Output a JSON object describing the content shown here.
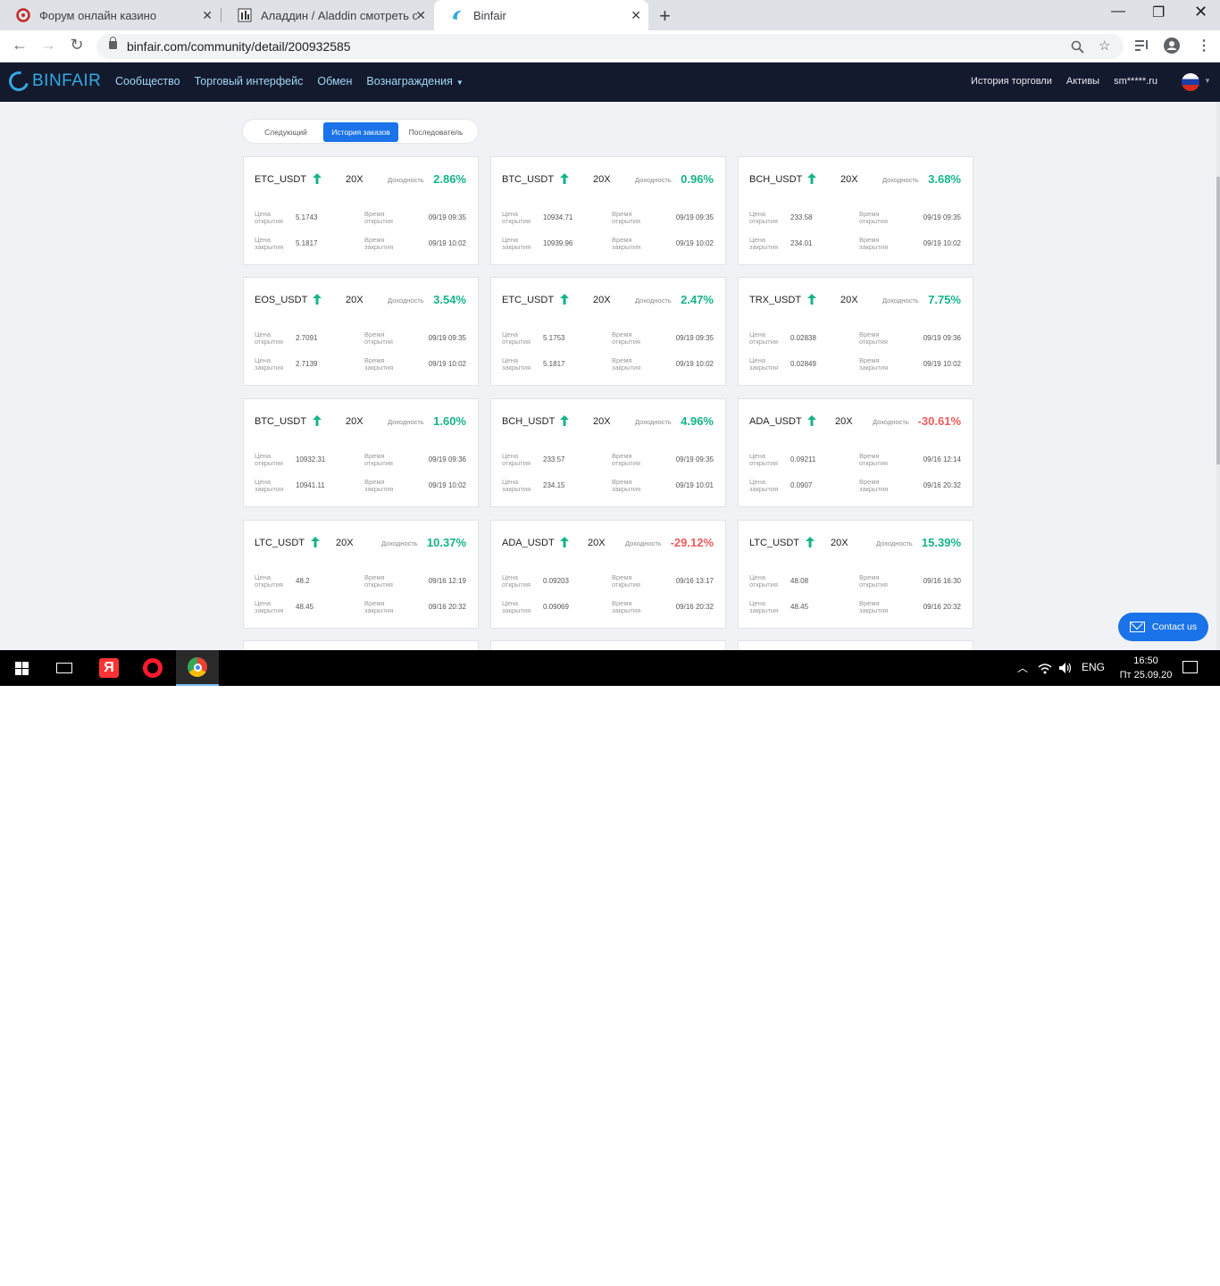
{
  "browser": {
    "tabs": [
      {
        "title": "Форум онлайн казино",
        "active": false
      },
      {
        "title": "Аладдин / Aladdin смотреть онл",
        "active": false
      },
      {
        "title": "Binfair",
        "active": true
      }
    ],
    "url": "binfair.com/community/detail/200932585"
  },
  "site": {
    "logo": "BINFAIR",
    "nav": {
      "community": "Сообщество",
      "trading": "Торговый интерфейс",
      "exchange": "Обмен",
      "rewards": "Вознаграждения"
    },
    "right": {
      "history": "История торговли",
      "assets": "Активы",
      "user": "sm*****.ru"
    }
  },
  "filters": {
    "following": "Следующий",
    "order_history": "История заказов",
    "follower": "Последователь"
  },
  "labels": {
    "yield": "Доходность",
    "open_price_1": "Цена",
    "open_price_2": "открытия",
    "close_price_1": "Цена",
    "close_price_2": "закрытия",
    "open_time_1": "Время",
    "open_time_2": "открытия",
    "close_time_1": "Время",
    "close_time_2": "закрытия"
  },
  "cards": [
    {
      "pair": "ETC_USDT",
      "lev": "20X",
      "yield": "2.86%",
      "positive": true,
      "open": "5.1743",
      "close": "5.1817",
      "open_time": "09/19 09:35",
      "close_time": "09/19 10:02"
    },
    {
      "pair": "BTC_USDT",
      "lev": "20X",
      "yield": "0.96%",
      "positive": true,
      "open": "10934.71",
      "close": "10939.96",
      "open_time": "09/19 09:35",
      "close_time": "09/19 10:02"
    },
    {
      "pair": "BCH_USDT",
      "lev": "20X",
      "yield": "3.68%",
      "positive": true,
      "open": "233.58",
      "close": "234.01",
      "open_time": "09/19 09:35",
      "close_time": "09/19 10:02"
    },
    {
      "pair": "EOS_USDT",
      "lev": "20X",
      "yield": "3.54%",
      "positive": true,
      "open": "2.7091",
      "close": "2.7139",
      "open_time": "09/19 09:35",
      "close_time": "09/19 10:02"
    },
    {
      "pair": "ETC_USDT",
      "lev": "20X",
      "yield": "2.47%",
      "positive": true,
      "open": "5.1753",
      "close": "5.1817",
      "open_time": "09/19 09:35",
      "close_time": "09/19 10:02"
    },
    {
      "pair": "TRX_USDT",
      "lev": "20X",
      "yield": "7.75%",
      "positive": true,
      "open": "0.02838",
      "close": "0.02849",
      "open_time": "09/19 09:36",
      "close_time": "09/19 10:02"
    },
    {
      "pair": "BTC_USDT",
      "lev": "20X",
      "yield": "1.60%",
      "positive": true,
      "open": "10932.31",
      "close": "10941.11",
      "open_time": "09/19 09:36",
      "close_time": "09/19 10:02"
    },
    {
      "pair": "BCH_USDT",
      "lev": "20X",
      "yield": "4.96%",
      "positive": true,
      "open": "233.57",
      "close": "234.15",
      "open_time": "09/19 09:35",
      "close_time": "09/19 10:01"
    },
    {
      "pair": "ADA_USDT",
      "lev": "20X",
      "yield": "-30.61%",
      "positive": false,
      "open": "0.09211",
      "close": "0.0907",
      "open_time": "09/16 12:14",
      "close_time": "09/16 20:32"
    },
    {
      "pair": "LTC_USDT",
      "lev": "20X",
      "yield": "10.37%",
      "positive": true,
      "open": "48.2",
      "close": "48.45",
      "open_time": "09/16 12:19",
      "close_time": "09/16 20:32"
    },
    {
      "pair": "ADA_USDT",
      "lev": "20X",
      "yield": "-29.12%",
      "positive": false,
      "open": "0.09203",
      "close": "0.09069",
      "open_time": "09/16 13:17",
      "close_time": "09/16 20:32"
    },
    {
      "pair": "LTC_USDT",
      "lev": "20X",
      "yield": "15.39%",
      "positive": true,
      "open": "48.08",
      "close": "48.45",
      "open_time": "09/16 16:30",
      "close_time": "09/16 20:32"
    }
  ],
  "contact": "Contact us",
  "taskbar": {
    "lang": "ENG",
    "time": "16:50",
    "date": "Пт 25.09.20",
    "yandex_letter": "Я"
  },
  "colors": {
    "positive": "#15b38a",
    "negative": "#ec5b5b",
    "accent": "#1a73e8",
    "header": "#141a2e"
  }
}
